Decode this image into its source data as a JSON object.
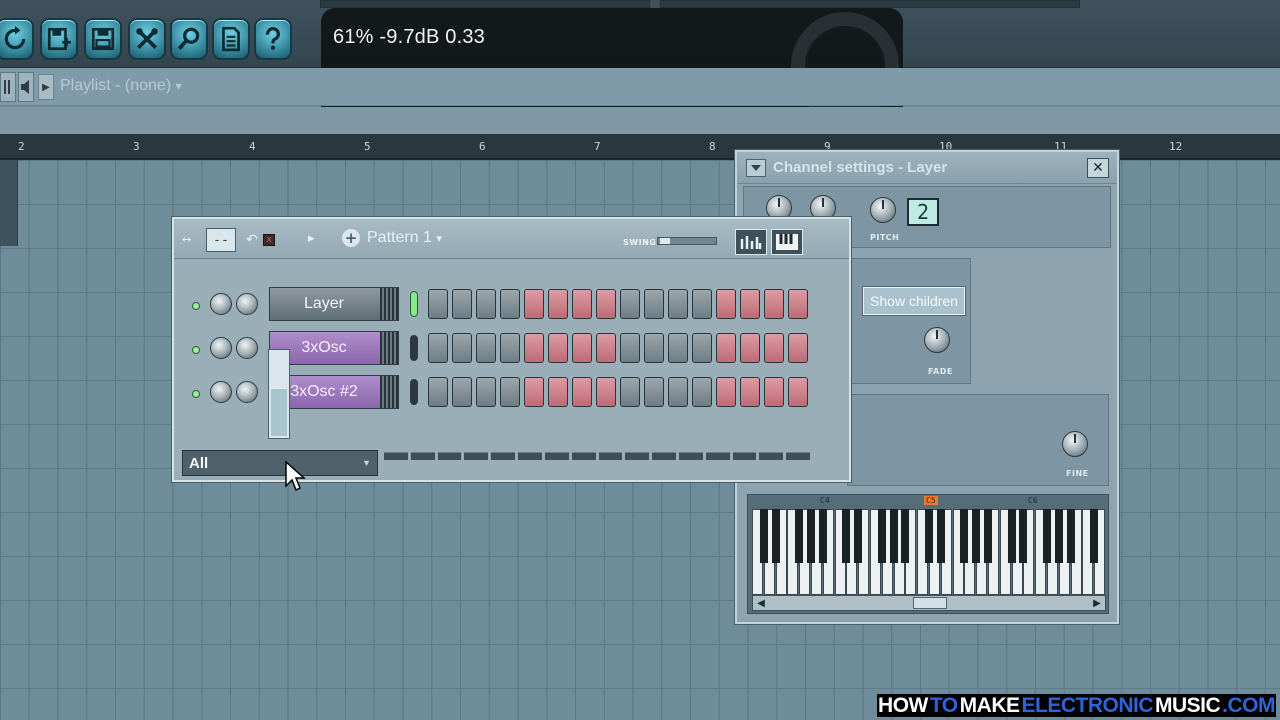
{
  "toolbar": {
    "buttons": [
      {
        "icon": "refresh-icon"
      },
      {
        "icon": "save-as-icon"
      },
      {
        "icon": "save-icon"
      },
      {
        "icon": "tools-icon"
      },
      {
        "icon": "search-icon"
      },
      {
        "icon": "document-icon"
      },
      {
        "icon": "help-icon"
      }
    ]
  },
  "hint": {
    "text": "61%  -9.7dB  0.33"
  },
  "playlist": {
    "title": "Playlist - (none)",
    "dropdown_glyph": "▾"
  },
  "ruler": {
    "labels": [
      "2",
      "3",
      "4",
      "5",
      "6",
      "7",
      "8",
      "9",
      "10",
      "11",
      "12"
    ]
  },
  "channel_settings": {
    "title": "Channel settings - Layer",
    "close_glyph": "✕",
    "pitch_label": "PITCH",
    "pitch_value": "2",
    "show_children_label": "Show children",
    "fade_label": "FADE",
    "fine_label": "FINE",
    "octave_labels": [
      "C4",
      "C5",
      "C6"
    ],
    "highlighted_octave": "C5",
    "colors": {
      "highlight": "#f07a2a"
    }
  },
  "sequencer": {
    "pattern_label": "Pattern 1",
    "pattern_add_glyph": "+",
    "dash_display": "--",
    "swing_label": "SWING",
    "filter_value": "All",
    "channels": [
      {
        "name": "Layer",
        "style": "grey",
        "selected": true,
        "steps": [
          "g",
          "g",
          "g",
          "g",
          "r",
          "r",
          "r",
          "r",
          "g",
          "g",
          "g",
          "g",
          "r",
          "r",
          "r",
          "r"
        ]
      },
      {
        "name": "3xOsc",
        "style": "purple",
        "selected": false,
        "steps": [
          "g",
          "g",
          "g",
          "g",
          "r",
          "r",
          "r",
          "r",
          "g",
          "g",
          "g",
          "g",
          "r",
          "r",
          "r",
          "r"
        ]
      },
      {
        "name": "3xOsc #2",
        "style": "purple",
        "selected": false,
        "steps": [
          "g",
          "g",
          "g",
          "g",
          "r",
          "r",
          "r",
          "r",
          "g",
          "g",
          "g",
          "g",
          "r",
          "r",
          "r",
          "r"
        ]
      }
    ],
    "volume_level": 0.55,
    "colors": {
      "step_on": "#d4848f",
      "step_off": "#8796a0",
      "led": "#98f09c"
    }
  },
  "watermark": {
    "parts": [
      {
        "text": "HOW",
        "color": "#ffffff",
        "bg": "#000000"
      },
      {
        "text": "TO",
        "color": "#2f64d8",
        "bg": "#000000"
      },
      {
        "text": "MAKE",
        "color": "#ffffff",
        "bg": "#000000"
      },
      {
        "text": "ELECTRONIC",
        "color": "#2f64d8",
        "bg": "#000000"
      },
      {
        "text": "MUSIC",
        "color": "#ffffff",
        "bg": "#000000"
      },
      {
        "text": ".COM",
        "color": "#2f64d8",
        "bg": "#000000"
      }
    ]
  }
}
